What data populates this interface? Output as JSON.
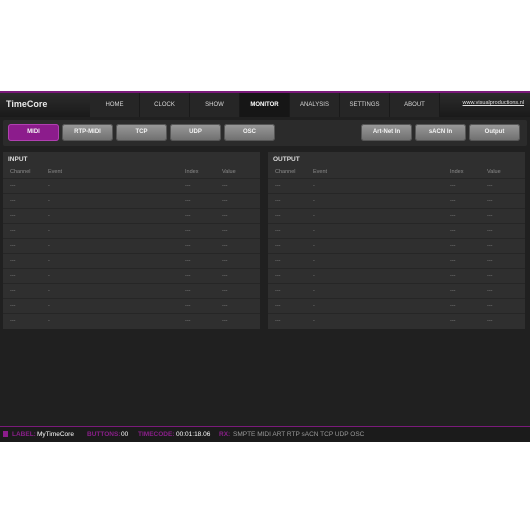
{
  "app": {
    "title": "TimeCore",
    "website": "www.visualproductions.nl"
  },
  "nav": [
    {
      "label": "HOME",
      "active": false
    },
    {
      "label": "CLOCK",
      "active": false
    },
    {
      "label": "SHOW CONTROL",
      "active": false
    },
    {
      "label": "MONITOR",
      "active": true
    },
    {
      "label": "ANALYSIS",
      "active": false
    },
    {
      "label": "SETTINGS",
      "active": false
    },
    {
      "label": "ABOUT",
      "active": false
    }
  ],
  "toolbar": {
    "left": [
      {
        "label": "MIDI",
        "active": true
      },
      {
        "label": "RTP-MIDI",
        "active": false
      },
      {
        "label": "TCP",
        "active": false
      },
      {
        "label": "UDP",
        "active": false
      },
      {
        "label": "OSC",
        "active": false
      }
    ],
    "right": [
      {
        "label": "Art-Net In",
        "active": false
      },
      {
        "label": "sACN In",
        "active": false
      },
      {
        "label": "Output",
        "active": false
      }
    ]
  },
  "input": {
    "title": "INPUT",
    "columns": [
      "Channel",
      "Event",
      "Index",
      "Value"
    ],
    "rows": [
      [
        "---",
        "-",
        "---",
        "---"
      ],
      [
        "---",
        "-",
        "---",
        "---"
      ],
      [
        "---",
        "-",
        "---",
        "---"
      ],
      [
        "---",
        "-",
        "---",
        "---"
      ],
      [
        "---",
        "-",
        "---",
        "---"
      ],
      [
        "---",
        "-",
        "---",
        "---"
      ],
      [
        "---",
        "-",
        "---",
        "---"
      ],
      [
        "---",
        "-",
        "---",
        "---"
      ],
      [
        "---",
        "-",
        "---",
        "---"
      ],
      [
        "---",
        "-",
        "---",
        "---"
      ]
    ]
  },
  "output": {
    "title": "OUTPUT",
    "columns": [
      "Channel",
      "Event",
      "Index",
      "Value"
    ],
    "rows": [
      [
        "---",
        "-",
        "---",
        "---"
      ],
      [
        "---",
        "-",
        "---",
        "---"
      ],
      [
        "---",
        "-",
        "---",
        "---"
      ],
      [
        "---",
        "-",
        "---",
        "---"
      ],
      [
        "---",
        "-",
        "---",
        "---"
      ],
      [
        "---",
        "-",
        "---",
        "---"
      ],
      [
        "---",
        "-",
        "---",
        "---"
      ],
      [
        "---",
        "-",
        "---",
        "---"
      ],
      [
        "---",
        "-",
        "---",
        "---"
      ],
      [
        "---",
        "-",
        "---",
        "---"
      ]
    ]
  },
  "status": {
    "label_key": "LABEL:",
    "label_val": "MyTimeCore",
    "buttons_key": "BUTTONS:",
    "buttons_val": "00",
    "timecode_key": "TIMECODE:",
    "timecode_val": "00:01:18.06",
    "rx_key": "RX:",
    "rx_vals": "SMPTE MIDI ART RTP sACN TCP UDP OSC"
  }
}
